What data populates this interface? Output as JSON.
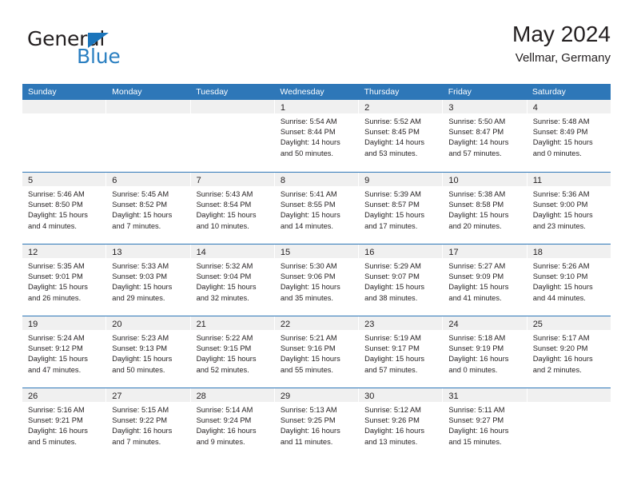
{
  "brand": {
    "name_top": "General",
    "name_bottom": "Blue",
    "triangle_color": "#1b75bb",
    "text_color": "#231f20",
    "blue_color": "#2a7fc1"
  },
  "header": {
    "title": "May 2024",
    "subtitle": "Vellmar, Germany"
  },
  "theme": {
    "header_bg": "#2e77b8",
    "header_text": "#ffffff",
    "day_head_bg": "#f0f0f0",
    "cell_bg": "#ffffff",
    "text": "#231f20"
  },
  "weekdays": [
    "Sunday",
    "Monday",
    "Tuesday",
    "Wednesday",
    "Thursday",
    "Friday",
    "Saturday"
  ],
  "weeks": [
    [
      {
        "day": "",
        "lines": []
      },
      {
        "day": "",
        "lines": []
      },
      {
        "day": "",
        "lines": []
      },
      {
        "day": "1",
        "lines": [
          "Sunrise: 5:54 AM",
          "Sunset: 8:44 PM",
          "Daylight: 14 hours",
          "and 50 minutes."
        ]
      },
      {
        "day": "2",
        "lines": [
          "Sunrise: 5:52 AM",
          "Sunset: 8:45 PM",
          "Daylight: 14 hours",
          "and 53 minutes."
        ]
      },
      {
        "day": "3",
        "lines": [
          "Sunrise: 5:50 AM",
          "Sunset: 8:47 PM",
          "Daylight: 14 hours",
          "and 57 minutes."
        ]
      },
      {
        "day": "4",
        "lines": [
          "Sunrise: 5:48 AM",
          "Sunset: 8:49 PM",
          "Daylight: 15 hours",
          "and 0 minutes."
        ]
      }
    ],
    [
      {
        "day": "5",
        "lines": [
          "Sunrise: 5:46 AM",
          "Sunset: 8:50 PM",
          "Daylight: 15 hours",
          "and 4 minutes."
        ]
      },
      {
        "day": "6",
        "lines": [
          "Sunrise: 5:45 AM",
          "Sunset: 8:52 PM",
          "Daylight: 15 hours",
          "and 7 minutes."
        ]
      },
      {
        "day": "7",
        "lines": [
          "Sunrise: 5:43 AM",
          "Sunset: 8:54 PM",
          "Daylight: 15 hours",
          "and 10 minutes."
        ]
      },
      {
        "day": "8",
        "lines": [
          "Sunrise: 5:41 AM",
          "Sunset: 8:55 PM",
          "Daylight: 15 hours",
          "and 14 minutes."
        ]
      },
      {
        "day": "9",
        "lines": [
          "Sunrise: 5:39 AM",
          "Sunset: 8:57 PM",
          "Daylight: 15 hours",
          "and 17 minutes."
        ]
      },
      {
        "day": "10",
        "lines": [
          "Sunrise: 5:38 AM",
          "Sunset: 8:58 PM",
          "Daylight: 15 hours",
          "and 20 minutes."
        ]
      },
      {
        "day": "11",
        "lines": [
          "Sunrise: 5:36 AM",
          "Sunset: 9:00 PM",
          "Daylight: 15 hours",
          "and 23 minutes."
        ]
      }
    ],
    [
      {
        "day": "12",
        "lines": [
          "Sunrise: 5:35 AM",
          "Sunset: 9:01 PM",
          "Daylight: 15 hours",
          "and 26 minutes."
        ]
      },
      {
        "day": "13",
        "lines": [
          "Sunrise: 5:33 AM",
          "Sunset: 9:03 PM",
          "Daylight: 15 hours",
          "and 29 minutes."
        ]
      },
      {
        "day": "14",
        "lines": [
          "Sunrise: 5:32 AM",
          "Sunset: 9:04 PM",
          "Daylight: 15 hours",
          "and 32 minutes."
        ]
      },
      {
        "day": "15",
        "lines": [
          "Sunrise: 5:30 AM",
          "Sunset: 9:06 PM",
          "Daylight: 15 hours",
          "and 35 minutes."
        ]
      },
      {
        "day": "16",
        "lines": [
          "Sunrise: 5:29 AM",
          "Sunset: 9:07 PM",
          "Daylight: 15 hours",
          "and 38 minutes."
        ]
      },
      {
        "day": "17",
        "lines": [
          "Sunrise: 5:27 AM",
          "Sunset: 9:09 PM",
          "Daylight: 15 hours",
          "and 41 minutes."
        ]
      },
      {
        "day": "18",
        "lines": [
          "Sunrise: 5:26 AM",
          "Sunset: 9:10 PM",
          "Daylight: 15 hours",
          "and 44 minutes."
        ]
      }
    ],
    [
      {
        "day": "19",
        "lines": [
          "Sunrise: 5:24 AM",
          "Sunset: 9:12 PM",
          "Daylight: 15 hours",
          "and 47 minutes."
        ]
      },
      {
        "day": "20",
        "lines": [
          "Sunrise: 5:23 AM",
          "Sunset: 9:13 PM",
          "Daylight: 15 hours",
          "and 50 minutes."
        ]
      },
      {
        "day": "21",
        "lines": [
          "Sunrise: 5:22 AM",
          "Sunset: 9:15 PM",
          "Daylight: 15 hours",
          "and 52 minutes."
        ]
      },
      {
        "day": "22",
        "lines": [
          "Sunrise: 5:21 AM",
          "Sunset: 9:16 PM",
          "Daylight: 15 hours",
          "and 55 minutes."
        ]
      },
      {
        "day": "23",
        "lines": [
          "Sunrise: 5:19 AM",
          "Sunset: 9:17 PM",
          "Daylight: 15 hours",
          "and 57 minutes."
        ]
      },
      {
        "day": "24",
        "lines": [
          "Sunrise: 5:18 AM",
          "Sunset: 9:19 PM",
          "Daylight: 16 hours",
          "and 0 minutes."
        ]
      },
      {
        "day": "25",
        "lines": [
          "Sunrise: 5:17 AM",
          "Sunset: 9:20 PM",
          "Daylight: 16 hours",
          "and 2 minutes."
        ]
      }
    ],
    [
      {
        "day": "26",
        "lines": [
          "Sunrise: 5:16 AM",
          "Sunset: 9:21 PM",
          "Daylight: 16 hours",
          "and 5 minutes."
        ]
      },
      {
        "day": "27",
        "lines": [
          "Sunrise: 5:15 AM",
          "Sunset: 9:22 PM",
          "Daylight: 16 hours",
          "and 7 minutes."
        ]
      },
      {
        "day": "28",
        "lines": [
          "Sunrise: 5:14 AM",
          "Sunset: 9:24 PM",
          "Daylight: 16 hours",
          "and 9 minutes."
        ]
      },
      {
        "day": "29",
        "lines": [
          "Sunrise: 5:13 AM",
          "Sunset: 9:25 PM",
          "Daylight: 16 hours",
          "and 11 minutes."
        ]
      },
      {
        "day": "30",
        "lines": [
          "Sunrise: 5:12 AM",
          "Sunset: 9:26 PM",
          "Daylight: 16 hours",
          "and 13 minutes."
        ]
      },
      {
        "day": "31",
        "lines": [
          "Sunrise: 5:11 AM",
          "Sunset: 9:27 PM",
          "Daylight: 16 hours",
          "and 15 minutes."
        ]
      },
      {
        "day": "",
        "lines": []
      }
    ]
  ]
}
